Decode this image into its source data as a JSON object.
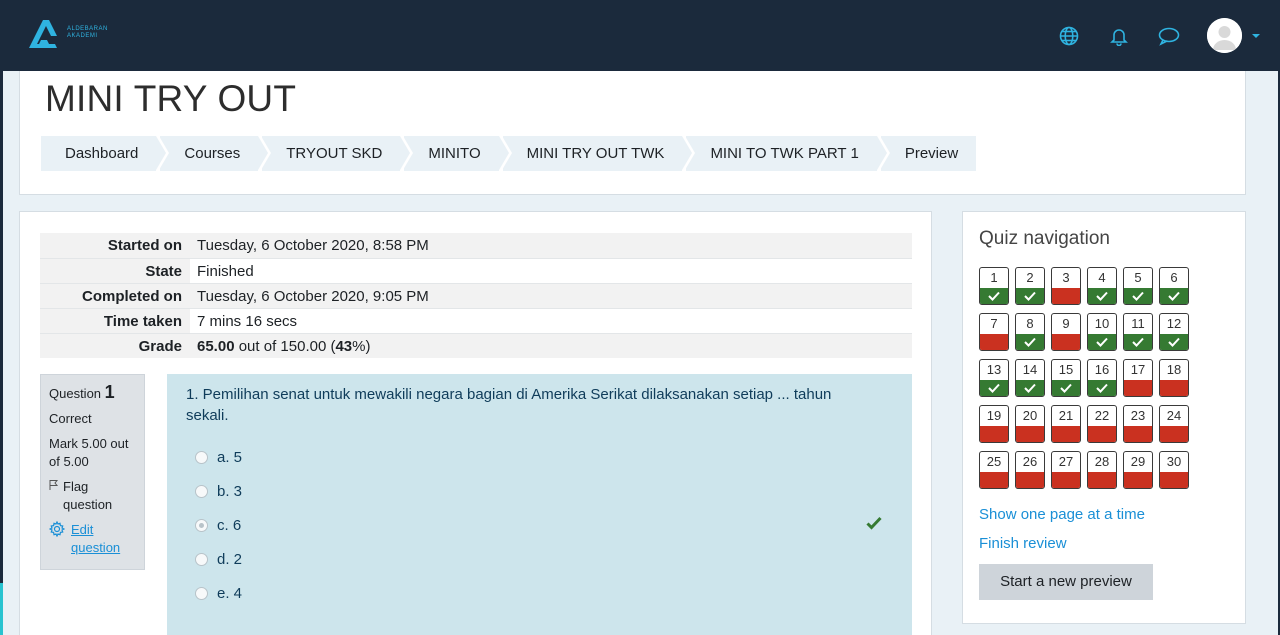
{
  "header": {
    "logo_text_line1": "ALDEBARAN",
    "logo_text_line2": "AKADEMI",
    "icons": [
      "globe-icon",
      "bell-icon",
      "chat-icon"
    ]
  },
  "page": {
    "title": "MINI TRY OUT",
    "breadcrumb": [
      "Dashboard",
      "Courses",
      "TRYOUT SKD",
      "MINITO",
      "MINI TRY OUT TWK",
      "MINI TO TWK PART 1",
      "Preview"
    ]
  },
  "summary": {
    "rows": [
      {
        "label": "Started on",
        "value": "Tuesday, 6 October 2020, 8:58 PM"
      },
      {
        "label": "State",
        "value": "Finished"
      },
      {
        "label": "Completed on",
        "value": "Tuesday, 6 October 2020, 9:05 PM"
      },
      {
        "label": "Time taken",
        "value": "7 mins 16 secs"
      }
    ],
    "grade_label": "Grade",
    "grade_score": "65.00",
    "grade_outof": " out of 150.00 (",
    "grade_percent": "43",
    "grade_tail": "%)"
  },
  "question": {
    "label": "Question",
    "number": "1",
    "status": "Correct",
    "mark": "Mark 5.00 out of 5.00",
    "flag": "Flag question",
    "edit": "Edit question",
    "text": "1. Pemilihan senat untuk mewakili negara bagian di Amerika Serikat dilaksanakan setiap ... tahun sekali.",
    "answers": [
      "a. 5",
      "b. 3",
      "c. 6",
      "d. 2",
      "e. 4"
    ],
    "selected_index": 2
  },
  "quiz_nav": {
    "title": "Quiz navigation",
    "questions": [
      {
        "n": "1",
        "s": "ok"
      },
      {
        "n": "2",
        "s": "ok"
      },
      {
        "n": "3",
        "s": "bad"
      },
      {
        "n": "4",
        "s": "ok"
      },
      {
        "n": "5",
        "s": "ok"
      },
      {
        "n": "6",
        "s": "ok"
      },
      {
        "n": "7",
        "s": "bad"
      },
      {
        "n": "8",
        "s": "ok"
      },
      {
        "n": "9",
        "s": "bad"
      },
      {
        "n": "10",
        "s": "ok"
      },
      {
        "n": "11",
        "s": "ok"
      },
      {
        "n": "12",
        "s": "ok"
      },
      {
        "n": "13",
        "s": "ok"
      },
      {
        "n": "14",
        "s": "ok"
      },
      {
        "n": "15",
        "s": "ok"
      },
      {
        "n": "16",
        "s": "ok"
      },
      {
        "n": "17",
        "s": "bad"
      },
      {
        "n": "18",
        "s": "bad"
      },
      {
        "n": "19",
        "s": "bad"
      },
      {
        "n": "20",
        "s": "bad"
      },
      {
        "n": "21",
        "s": "bad"
      },
      {
        "n": "22",
        "s": "bad"
      },
      {
        "n": "23",
        "s": "bad"
      },
      {
        "n": "24",
        "s": "bad"
      },
      {
        "n": "25",
        "s": "bad"
      },
      {
        "n": "26",
        "s": "bad"
      },
      {
        "n": "27",
        "s": "bad"
      },
      {
        "n": "28",
        "s": "bad"
      },
      {
        "n": "29",
        "s": "bad"
      },
      {
        "n": "30",
        "s": "bad"
      }
    ],
    "show_one_page": "Show one page at a time",
    "finish_review": "Finish review",
    "start_new": "Start a new preview"
  },
  "colors": {
    "navbar": "#1b2a3c",
    "accent": "#2fb3e0",
    "correct": "#357a32",
    "incorrect": "#ca3120",
    "question_bg": "#cde5ec"
  }
}
